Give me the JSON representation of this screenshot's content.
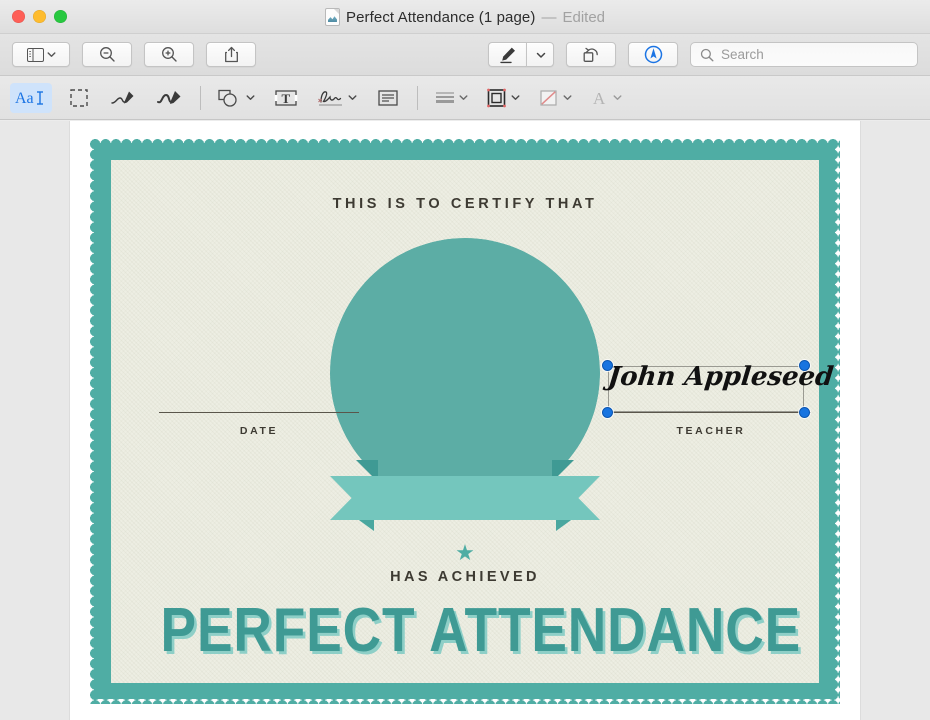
{
  "window": {
    "traffic_lights": [
      "close",
      "minimize",
      "zoom"
    ],
    "title": "Perfect Attendance (1 page)",
    "title_separator": "—",
    "title_status": "Edited"
  },
  "toolbar": {
    "sidebar_button": "sidebar-toggle",
    "zoom_out_button": "zoom-out",
    "zoom_in_button": "zoom-in",
    "share_button": "share",
    "markup_pen_button": "markup-pen",
    "markup_pen_dropdown": "markup-pen-options",
    "rotate_button": "rotate-left",
    "annotate_button": "show-markup-toolbar",
    "search": {
      "placeholder": "Search",
      "value": ""
    }
  },
  "markup_toolbar": {
    "items": [
      {
        "name": "text-selection",
        "icon": "AaI",
        "active": true
      },
      {
        "name": "rectangular-selection",
        "icon": "dashed-rect",
        "active": false
      },
      {
        "name": "sketch",
        "icon": "sketch-pen",
        "active": false
      },
      {
        "name": "draw",
        "icon": "draw-marker",
        "active": false
      },
      {
        "name": "shapes",
        "icon": "shapes",
        "active": false,
        "has_menu": true
      },
      {
        "name": "text",
        "icon": "text-box",
        "active": false
      },
      {
        "name": "sign",
        "icon": "signature",
        "active": false,
        "has_menu": true
      },
      {
        "name": "note",
        "icon": "note",
        "active": false
      },
      {
        "name": "shape-style",
        "icon": "line-weights",
        "active": false,
        "has_menu": true
      },
      {
        "name": "border-color",
        "icon": "border-square",
        "active": false,
        "has_menu": true
      },
      {
        "name": "fill-color",
        "icon": "fill-swatch",
        "active": false,
        "has_menu": true
      },
      {
        "name": "text-style",
        "icon": "letter-a",
        "active": false,
        "has_menu": true
      }
    ]
  },
  "certificate": {
    "certify_text": "THIS IS TO CERTIFY THAT",
    "achieved_text": "HAS ACHIEVED",
    "award_title": "PERFECT ATTENDANCE",
    "star_glyph": "★",
    "date_label": "DATE",
    "teacher_label": "TEACHER",
    "signature_value": "John Appleseed",
    "colors": {
      "border_teal": "#4fada4",
      "paper_cream": "#edeee3",
      "seal_teal": "#5cada5",
      "ribbon_light": "#74c6bd",
      "ribbon_dark": "#3f9a94",
      "title_teal": "#3f9a94",
      "title_shadow": "#8ecfc7",
      "ink": "#3d3a32",
      "selection_blue": "#1874e0"
    }
  }
}
